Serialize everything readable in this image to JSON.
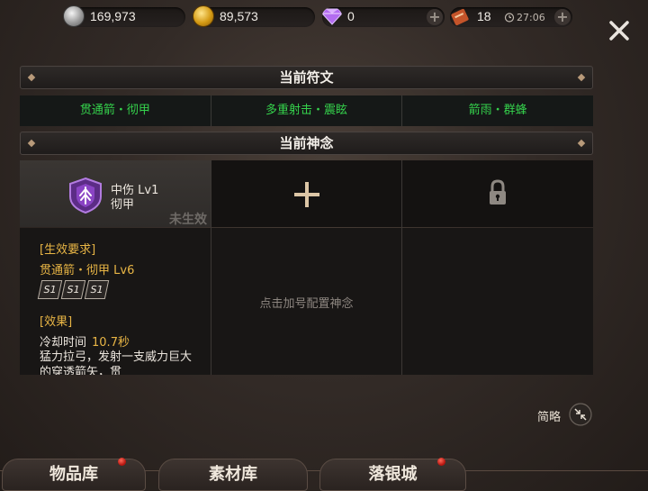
{
  "topbar": {
    "silver": "169,973",
    "gold": "89,573",
    "gems": "0",
    "tickets": "18",
    "timer": "27:06"
  },
  "sections": {
    "runes_title": "当前符文",
    "shennian_title": "当前神念"
  },
  "runes": [
    "贯通箭・彻甲",
    "多重射击・震眩",
    "箭雨・群蜂"
  ],
  "shennian": {
    "slot1": {
      "name": "中伤 Lv1",
      "sub": "彻甲",
      "status": "未生效",
      "req_title": "[生效要求]",
      "req_text": "贯通箭・彻甲 Lv6",
      "s_icons": [
        "S1",
        "S1",
        "S1"
      ],
      "effect_title": "[效果]",
      "cooldown_label": "冷却时间",
      "cooldown_value": "10.7秒",
      "effect_desc": "猛力拉弓，发射一支威力巨大的穿透箭矢，贯"
    },
    "slot2_hint": "点击加号配置神念"
  },
  "footer": {
    "brief_label": "简略",
    "tabs": [
      "物品库",
      "素材库",
      "落银城"
    ]
  },
  "colors": {
    "rune_green": "#35d24c",
    "gold_text": "#e8b545",
    "notify_red": "#c0180f"
  },
  "icons": [
    "silver-coin-icon",
    "gold-coin-icon",
    "diamond-icon",
    "ticket-icon",
    "alarm-icon",
    "close-icon",
    "emblem-icon",
    "plus-icon",
    "lock-icon",
    "collapse-icon"
  ]
}
